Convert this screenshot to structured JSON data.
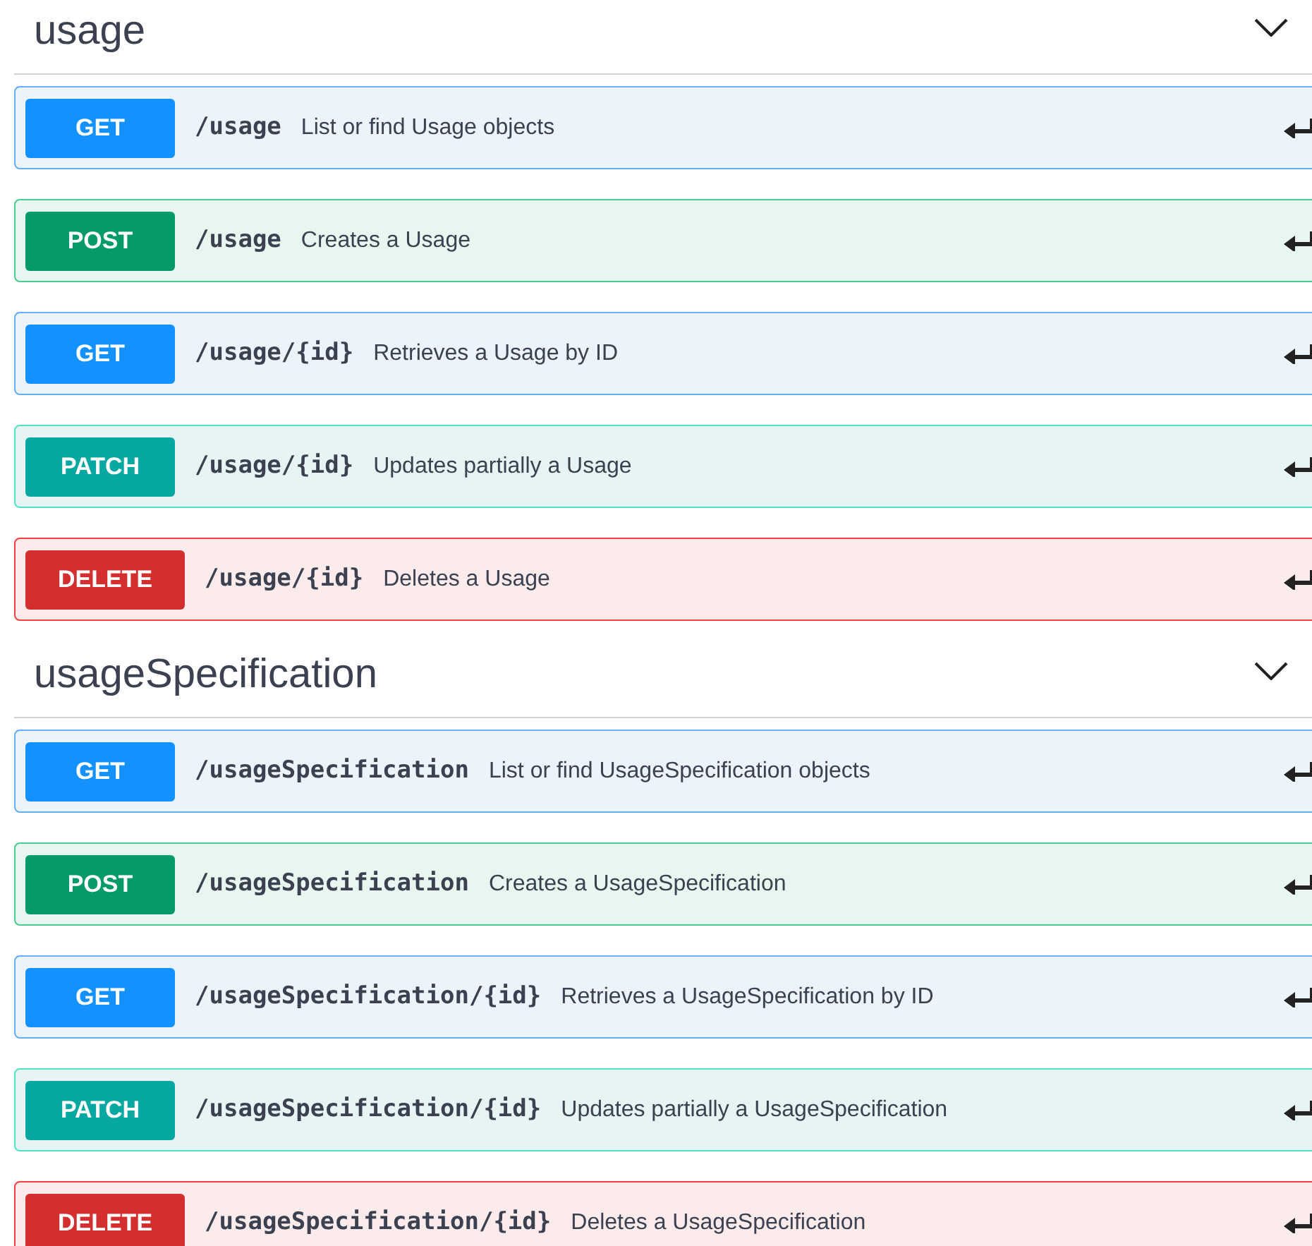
{
  "sections": [
    {
      "title": "usage",
      "expanded": true,
      "operations": [
        {
          "kind": "get",
          "method": "GET",
          "path": "/usage",
          "summary": "List or find Usage objects"
        },
        {
          "kind": "post",
          "method": "POST",
          "path": "/usage",
          "summary": "Creates a Usage"
        },
        {
          "kind": "get",
          "method": "GET",
          "path": "/usage/{id}",
          "summary": "Retrieves a Usage by ID"
        },
        {
          "kind": "patch",
          "method": "PATCH",
          "path": "/usage/{id}",
          "summary": "Updates partially a Usage"
        },
        {
          "kind": "delete",
          "method": "DELETE",
          "path": "/usage/{id}",
          "summary": "Deletes a Usage"
        }
      ]
    },
    {
      "title": "usageSpecification",
      "expanded": true,
      "operations": [
        {
          "kind": "get",
          "method": "GET",
          "path": "/usageSpecification",
          "summary": "List or find UsageSpecification objects"
        },
        {
          "kind": "post",
          "method": "POST",
          "path": "/usageSpecification",
          "summary": "Creates a UsageSpecification"
        },
        {
          "kind": "get",
          "method": "GET",
          "path": "/usageSpecification/{id}",
          "summary": "Retrieves a UsageSpecification by ID"
        },
        {
          "kind": "patch",
          "method": "PATCH",
          "path": "/usageSpecification/{id}",
          "summary": "Updates partially a UsageSpecification"
        },
        {
          "kind": "delete",
          "method": "DELETE",
          "path": "/usageSpecification/{id}",
          "summary": "Deletes a UsageSpecification"
        }
      ]
    }
  ]
}
